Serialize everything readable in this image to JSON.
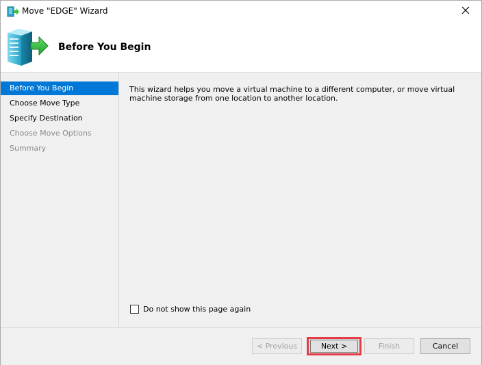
{
  "window": {
    "title": "Move \"EDGE\" Wizard",
    "close_icon": "close-icon"
  },
  "banner": {
    "title": "Before You Begin",
    "icon": "server-move-icon"
  },
  "sidebar": {
    "items": [
      {
        "label": "Before You Begin",
        "state": "active"
      },
      {
        "label": "Choose Move Type",
        "state": "enabled"
      },
      {
        "label": "Specify Destination",
        "state": "enabled"
      },
      {
        "label": "Choose Move Options",
        "state": "disabled"
      },
      {
        "label": "Summary",
        "state": "disabled"
      }
    ]
  },
  "content": {
    "intro_text": "This wizard helps you move a virtual machine to a different computer, or move virtual machine storage from one location to another location.",
    "checkbox_label": "Do not show this page again",
    "checkbox_checked": false
  },
  "footer": {
    "previous_label": "< Previous",
    "next_label": "Next >",
    "finish_label": "Finish",
    "cancel_label": "Cancel"
  },
  "colors": {
    "accent": "#0078d7",
    "highlight_border": "#e63b46"
  }
}
